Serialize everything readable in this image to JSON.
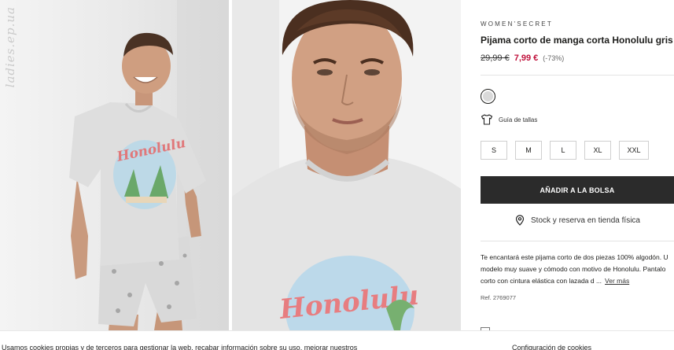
{
  "gallery": {
    "watermark": "ladies.ep.ua",
    "images": [
      {
        "alt": "Modelo con pijama corto gris Honolulu, cuerpo entero",
        "print_text": "Honolulu"
      },
      {
        "alt": "Detalle del rostro del modelo con camiseta Honolulu",
        "print_text": "Honolulu"
      }
    ]
  },
  "product": {
    "brand": "WOMEN'SECRET",
    "title": "Pijama corto de manga corta Honolulu gris",
    "price_old": "29,99 €",
    "price_new": "7,99 €",
    "discount": "(-73%)",
    "swatch_color": "#d9d9d9",
    "size_guide_label": "Guía de tallas",
    "sizes": [
      "S",
      "M",
      "L",
      "XL",
      "XXL"
    ],
    "add_to_bag_label": "AÑADIR A LA BOLSA",
    "stock_label": "Stock y reserva en tienda física",
    "description_lines": [
      "Te encantará este pijama corto de dos piezas 100% algodón. U",
      "modelo muy suave y cómodo con motivo de Honolulu. Pantalo",
      "corto con cintura elástica con lazada d ..."
    ],
    "see_more_label": "Ver más",
    "reference": "Ref. 2769077"
  },
  "cookie_bar": {
    "text": "Usamos cookies propias y de terceros para gestionar la web, recabar información sobre su uso, mejorar nuestros",
    "config_label": "Configuración de cookies"
  },
  "colors": {
    "accent_price": "#c0123c",
    "button_bg": "#2b2b2b"
  }
}
